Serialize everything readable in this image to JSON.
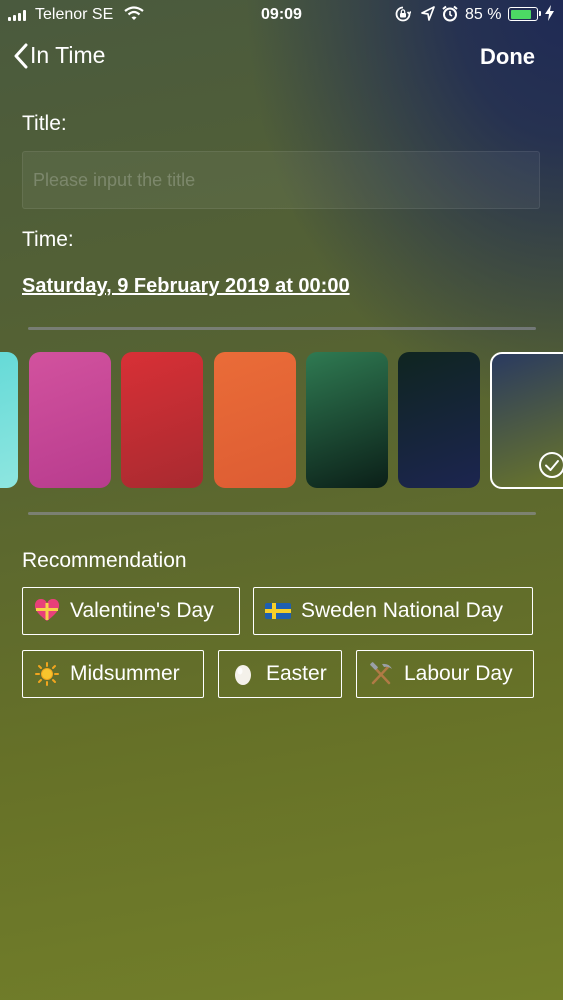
{
  "status_bar": {
    "carrier": "Telenor SE",
    "time": "09:09",
    "battery": "85 %",
    "battery_level": 0.85,
    "battery_color": "#4cd964"
  },
  "nav": {
    "back_label": "In Time",
    "done_label": "Done"
  },
  "form": {
    "title_label": "Title:",
    "title_value": "",
    "title_placeholder": "Please input the title",
    "time_label": "Time:",
    "time_value": "Saturday, 9 February 2019 at 00:00"
  },
  "backgrounds": [
    {
      "name": "teal",
      "colors": [
        "#5fd8d6",
        "#8ee6e0"
      ],
      "selected": false
    },
    {
      "name": "pink",
      "colors": [
        "#d2529e",
        "#b83c8e"
      ],
      "selected": false
    },
    {
      "name": "red",
      "colors": [
        "#d83036",
        "#a82a30"
      ],
      "selected": false
    },
    {
      "name": "orange",
      "colors": [
        "#ea6c38",
        "#dd5c33"
      ],
      "selected": false
    },
    {
      "name": "green",
      "colors": [
        "#2f7a52",
        "#0b1f18"
      ],
      "selected": false
    },
    {
      "name": "navy",
      "colors": [
        "#0f2520",
        "#1c2550"
      ],
      "selected": false
    },
    {
      "name": "olive",
      "colors": [
        "#2a3a60",
        "#6b772a"
      ],
      "selected": true
    }
  ],
  "recommendation": {
    "title": "Recommendation",
    "items": [
      {
        "label": "Valentine's Day",
        "icon": "heart-gift-icon"
      },
      {
        "label": "Sweden National Day",
        "icon": "sweden-flag-icon"
      },
      {
        "label": "Midsummer",
        "icon": "sun-icon"
      },
      {
        "label": "Easter",
        "icon": "egg-icon"
      },
      {
        "label": "Labour Day",
        "icon": "hammer-pick-icon"
      }
    ]
  }
}
